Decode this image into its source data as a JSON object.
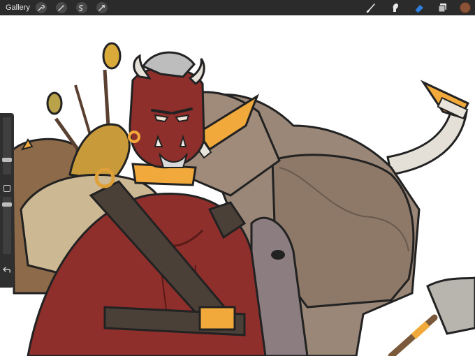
{
  "toolbar": {
    "gallery_label": "Gallery",
    "left_tools": [
      {
        "name": "wrench-icon"
      },
      {
        "name": "magic-wand-icon"
      },
      {
        "name": "selection-icon"
      },
      {
        "name": "transform-arrow-icon"
      }
    ],
    "right_tools": [
      {
        "name": "brush-icon"
      },
      {
        "name": "smudge-icon"
      },
      {
        "name": "eraser-icon"
      },
      {
        "name": "layers-icon"
      }
    ],
    "active_tool": "eraser-icon",
    "active_color": "#8a5236",
    "accent_color": "#2f7fe0"
  },
  "sidebar": {
    "brush_size": 0.75,
    "brush_opacity": 0.2,
    "controls": [
      "brush-size-slider",
      "modify-button",
      "brush-opacity-slider",
      "undo-button"
    ]
  },
  "canvas": {
    "subject": "illustration",
    "palette": {
      "skin": "#8e2f2c",
      "fur": "#9b8778",
      "horn": "#e4e0d8",
      "gold": "#f0a93a",
      "leather": "#4a4038"
    }
  }
}
